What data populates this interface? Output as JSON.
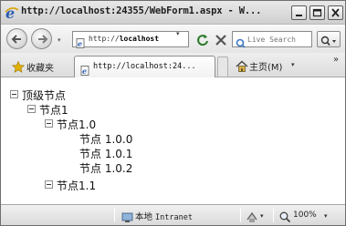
{
  "window": {
    "title": "http://localhost:24355/WebForm1.aspx - W..."
  },
  "address_bar": {
    "url_prefix": "http://",
    "url_host": "localhost",
    "url_dropdown": "▾",
    "search_placeholder": "Live Search",
    "search_go": "ρ▾"
  },
  "favorites_bar": {
    "favorites_label": "收藏夹",
    "tab_label": "http://localhost:24...",
    "home_label": "主页(M)",
    "home_dropdown": "▾",
    "more": "»"
  },
  "tree": {
    "nodes": [
      {
        "label": "顶级节点",
        "toggle": true
      },
      {
        "label": "节点1",
        "toggle": true
      },
      {
        "label": "节点1.0",
        "toggle": true
      },
      {
        "label": "节点 1.0.0",
        "toggle": false
      },
      {
        "label": "节点 1.0.1",
        "toggle": false
      },
      {
        "label": "节点 1.0.2",
        "toggle": false
      },
      {
        "label": "节点1.1",
        "toggle": true
      }
    ]
  },
  "status_bar": {
    "zone_label": "本地",
    "zone_name": "Intranet",
    "zoom": "100%",
    "dropdown": "▾"
  },
  "colors": {
    "title_bar": "#d9d9d9",
    "window_border": "#6f6f6f",
    "content_bg": "#ffffff"
  },
  "icons": [
    "ie-icon",
    "minimize-icon",
    "maximize-icon",
    "close-icon",
    "back-icon",
    "forward-icon",
    "page-icon",
    "refresh-icon",
    "stop-icon",
    "live-search-icon",
    "search-icon",
    "star-icon",
    "home-icon",
    "globe-icon",
    "security-icon",
    "zoom-icon"
  ]
}
